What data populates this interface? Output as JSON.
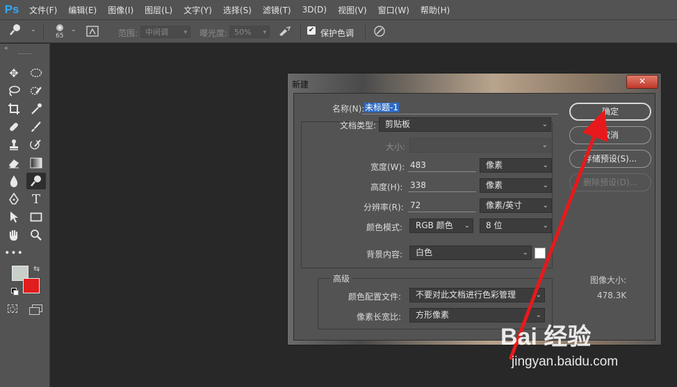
{
  "app": {
    "logo": "Ps"
  },
  "menu": [
    "文件(F)",
    "编辑(E)",
    "图像(I)",
    "图层(L)",
    "文字(Y)",
    "选择(S)",
    "滤镜(T)",
    "3D(D)",
    "视图(V)",
    "窗口(W)",
    "帮助(H)"
  ],
  "options": {
    "brush_size": "65",
    "range_label": "范围:",
    "range_value": "中间调",
    "exposure_label": "曝光度:",
    "exposure_value": "50%",
    "protect_tones": "保护色调"
  },
  "dialog": {
    "title": "新建",
    "close": "✕",
    "name_label": "名称(N):",
    "name_value": "未标题-1",
    "doc_type_label": "文档类型:",
    "doc_type_value": "剪贴板",
    "size_label": "大小:",
    "width_label": "宽度(W):",
    "width_value": "483",
    "width_unit": "像素",
    "height_label": "高度(H):",
    "height_value": "338",
    "height_unit": "像素",
    "resolution_label": "分辨率(R):",
    "resolution_value": "72",
    "resolution_unit": "像素/英寸",
    "color_mode_label": "颜色模式:",
    "color_mode_value": "RGB 颜色",
    "bit_depth_value": "8 位",
    "background_label": "背景内容:",
    "background_value": "白色",
    "advanced_label": "高级",
    "color_profile_label": "颜色配置文件:",
    "color_profile_value": "不要对此文档进行色彩管理",
    "pixel_aspect_label": "像素长宽比:",
    "pixel_aspect_value": "方形像素",
    "ok_button": "确定",
    "cancel_button": "取消",
    "save_preset_button": "存储预设(S)...",
    "delete_preset_button": "删除预设(D)...",
    "image_size_label": "图像大小:",
    "image_size_value": "478.3K"
  },
  "watermark": {
    "brand": "Bai 经验",
    "url": "jingyan.baidu.com"
  },
  "colors": {
    "foreground": "#c9d0c9",
    "background": "#e11d1d",
    "accent_arrow": "#e8191c"
  }
}
